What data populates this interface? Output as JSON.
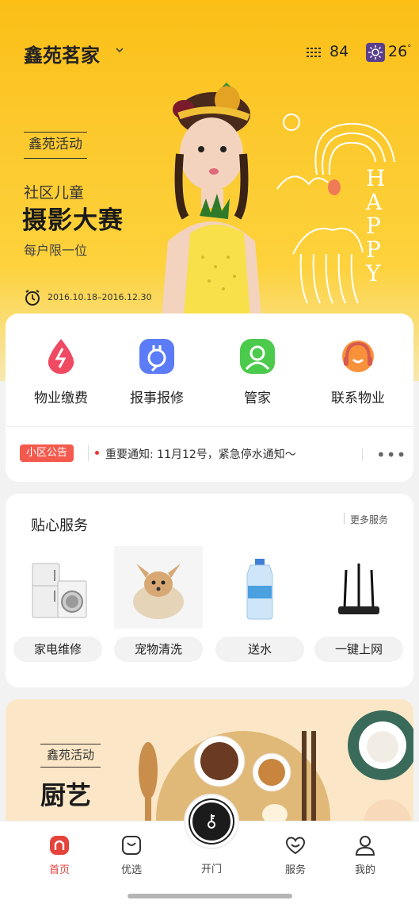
{
  "header": {
    "community": "鑫苑茗家",
    "aqi_value": "84",
    "temperature": "26",
    "temperature_unit": "°",
    "icons": [
      "chevron-down-icon",
      "air-quality-icon",
      "sun-icon"
    ]
  },
  "banner": {
    "tag": "鑫苑活动",
    "line1": "社区儿童",
    "title": "摄影大赛",
    "subtitle": "每户限一位",
    "date_range": "2016.10.18–2016.12.30",
    "doodle_text": "HAPPY"
  },
  "quick_services": [
    {
      "label": "物业缴费",
      "icon": "payment-drop-icon",
      "color": "#f04a63"
    },
    {
      "label": "报事报修",
      "icon": "plug-icon",
      "color": "#5b7cf6"
    },
    {
      "label": "管家",
      "icon": "butler-icon",
      "color": "#4cca4c"
    },
    {
      "label": "联系物业",
      "icon": "headset-icon",
      "color": "#f7923a"
    }
  ],
  "notice": {
    "badge": "小区公告",
    "text": "重要通知: 11月12号，紧急停水通知～",
    "more": "•••"
  },
  "care": {
    "title": "贴心服务",
    "more": "更多服务",
    "items": [
      {
        "label": "家电维修",
        "icon": "appliance-icon"
      },
      {
        "label": "宠物清洗",
        "icon": "pet-icon"
      },
      {
        "label": "送水",
        "icon": "water-bottle-icon"
      },
      {
        "label": "一键上网",
        "icon": "router-icon"
      }
    ]
  },
  "promo": {
    "tag": "鑫苑活动",
    "title": "厨艺"
  },
  "tabbar": {
    "tabs": [
      {
        "label": "首页",
        "icon": "home-icon",
        "active": true
      },
      {
        "label": "优选",
        "icon": "bag-icon",
        "active": false
      },
      {
        "label": "开门",
        "icon": "key-icon",
        "active": false
      },
      {
        "label": "服务",
        "icon": "heart-icon",
        "active": false
      },
      {
        "label": "我的",
        "icon": "profile-icon",
        "active": false
      }
    ]
  },
  "colors": {
    "brand_yellow": "#fcc82b",
    "accent_red": "#e5423b",
    "notice_badge": "#f35a4d"
  }
}
